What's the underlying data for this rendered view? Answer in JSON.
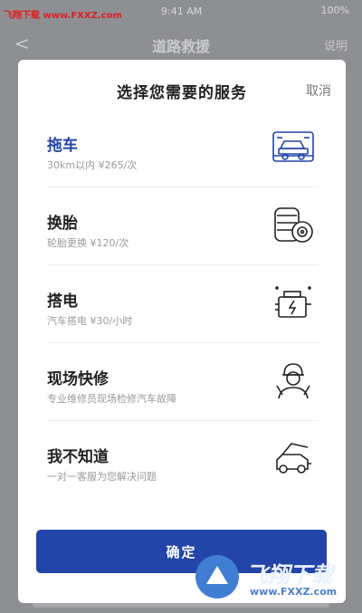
{
  "watermark": {
    "top_text": "飞翔下载 www.FXXZ.com",
    "logo_text": "飞翔下载",
    "logo_url": "www.FXXZ.com"
  },
  "statusbar": {
    "time": "9:41 AM",
    "battery": "100%"
  },
  "background": {
    "title": "道路救援",
    "back": "<",
    "help": "说明"
  },
  "sheet": {
    "title": "选择您需要的服务",
    "cancel": "取消",
    "options": [
      {
        "name": "拖车",
        "desc": "30km以内 ¥265/次",
        "icon": "tow-truck-icon",
        "selected": true
      },
      {
        "name": "换胎",
        "desc": "轮胎更换 ¥120/次",
        "icon": "tire-icon",
        "selected": false
      },
      {
        "name": "搭电",
        "desc": "汽车搭电 ¥30/小时",
        "icon": "battery-icon",
        "selected": false
      },
      {
        "name": "现场快修",
        "desc": "专业维修员现场检修汽车故障",
        "icon": "mechanic-icon",
        "selected": false
      },
      {
        "name": "我不知道",
        "desc": "一对一客服为您解决问题",
        "icon": "car-hood-icon",
        "selected": false
      }
    ],
    "confirm": "确定"
  },
  "colors": {
    "accent": "#2344a8",
    "overlay": "#8d8f93",
    "sheet_bg": "#ffffff"
  }
}
